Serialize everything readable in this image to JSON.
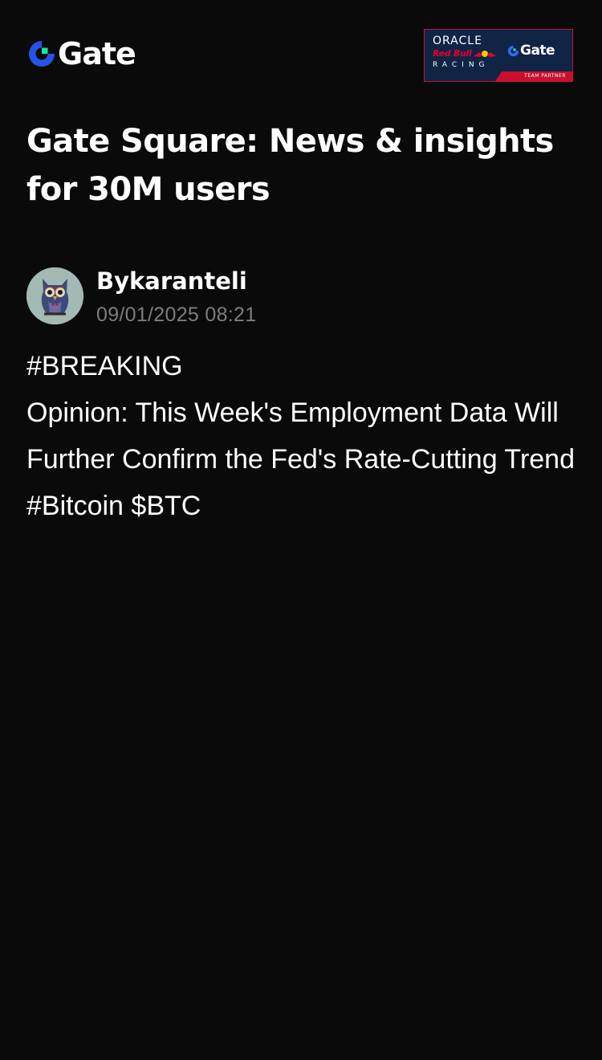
{
  "header": {
    "brand_name": "Gate",
    "brand_icon": "gate-logo-icon",
    "accent_colors": {
      "blue": "#2354e6",
      "teal": "#17e6a1"
    },
    "partner_badge": {
      "oracle": "ORACLE",
      "red_bull": "Red Bull",
      "racing": "RACING",
      "partner_brand": "Gate",
      "tag": "TEAM PARTNER",
      "colors": {
        "background": "#102446",
        "red": "#c8102e"
      }
    }
  },
  "headline": "Gate Square: News & insights for 30M users",
  "post": {
    "author": "Bykaranteli",
    "timestamp": "09/01/2025 08:21",
    "avatar_icon": "owl-avatar",
    "lines": [
      "#BREAKING",
      "Opinion: This Week's Employment Data Will Further Confirm the Fed's Rate-Cutting Trend",
      "#Bitcoin $BTC"
    ]
  }
}
